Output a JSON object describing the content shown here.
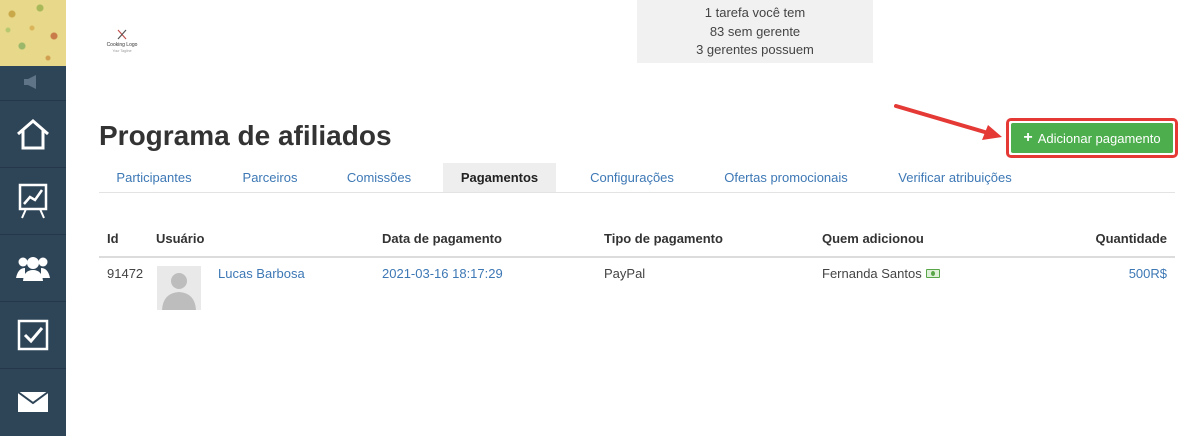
{
  "notice": {
    "line1": "1 tarefa você tem",
    "line2": "83 sem gerente",
    "line3": "3 gerentes possuem"
  },
  "logo": {
    "text": "Cooking Logo",
    "tagline": "Your Tagline"
  },
  "page_title": "Programa de afiliados",
  "add_button": {
    "label": "Adicionar pagamento",
    "plus": "+"
  },
  "tabs": [
    {
      "label": "Participantes"
    },
    {
      "label": "Parceiros"
    },
    {
      "label": "Comissões"
    },
    {
      "label": "Pagamentos"
    },
    {
      "label": "Configurações"
    },
    {
      "label": "Ofertas promocionais"
    },
    {
      "label": "Verificar atribuições"
    }
  ],
  "table": {
    "headers": {
      "id": "Id",
      "user": "Usuário",
      "date": "Data de pagamento",
      "type": "Tipo de pagamento",
      "added_by": "Quem adicionou",
      "amount": "Quantidade"
    },
    "rows": [
      {
        "id": "91472",
        "user": "Lucas Barbosa",
        "date": "2021-03-16 18:17:29",
        "type": "PayPal",
        "added_by": "Fernanda Santos",
        "amount": "500R$"
      }
    ]
  },
  "colors": {
    "sidebar": "#2e4457",
    "accent_button": "#4cae4c",
    "highlight": "#e53935",
    "link": "#3d78b5"
  }
}
